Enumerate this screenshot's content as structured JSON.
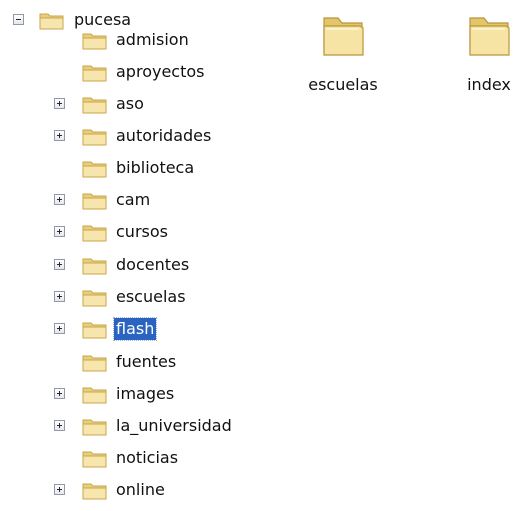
{
  "tree": {
    "root": {
      "label": "pucesa",
      "state": "expanded"
    },
    "children": [
      {
        "label": "admision",
        "expander": "none"
      },
      {
        "label": "aproyectos",
        "expander": "none"
      },
      {
        "label": "aso",
        "expander": "plus"
      },
      {
        "label": "autoridades",
        "expander": "plus"
      },
      {
        "label": "biblioteca",
        "expander": "none"
      },
      {
        "label": "cam",
        "expander": "plus"
      },
      {
        "label": "cursos",
        "expander": "plus"
      },
      {
        "label": "docentes",
        "expander": "plus"
      },
      {
        "label": "escuelas",
        "expander": "plus"
      },
      {
        "label": "flash",
        "expander": "plus",
        "selected": true
      },
      {
        "label": "fuentes",
        "expander": "none"
      },
      {
        "label": "images",
        "expander": "plus"
      },
      {
        "label": "la_universidad",
        "expander": "plus"
      },
      {
        "label": "noticias",
        "expander": "none"
      },
      {
        "label": "online",
        "expander": "plus"
      }
    ]
  },
  "content": {
    "items": [
      {
        "label": "escuelas",
        "icon": "folder-icon"
      },
      {
        "label": "index",
        "icon": "folder-icon"
      }
    ]
  },
  "colors": {
    "selection": "#2a64c0",
    "folder_fill": "#f4e2a3",
    "folder_stroke": "#c9a64a"
  }
}
